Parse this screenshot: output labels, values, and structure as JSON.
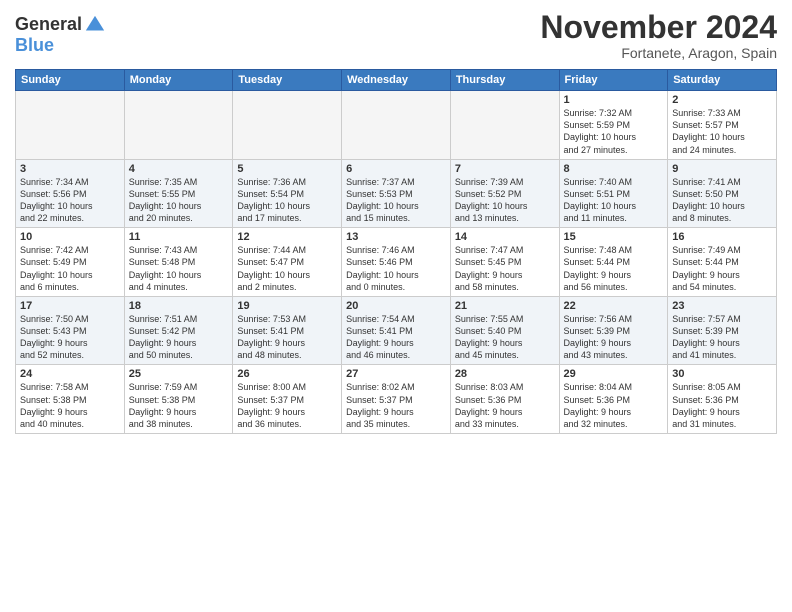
{
  "logo": {
    "line1": "General",
    "line2": "Blue"
  },
  "title": "November 2024",
  "subtitle": "Fortanete, Aragon, Spain",
  "weekdays": [
    "Sunday",
    "Monday",
    "Tuesday",
    "Wednesday",
    "Thursday",
    "Friday",
    "Saturday"
  ],
  "rows": [
    [
      {
        "day": "",
        "info": ""
      },
      {
        "day": "",
        "info": ""
      },
      {
        "day": "",
        "info": ""
      },
      {
        "day": "",
        "info": ""
      },
      {
        "day": "",
        "info": ""
      },
      {
        "day": "1",
        "info": "Sunrise: 7:32 AM\nSunset: 5:59 PM\nDaylight: 10 hours\nand 27 minutes."
      },
      {
        "day": "2",
        "info": "Sunrise: 7:33 AM\nSunset: 5:57 PM\nDaylight: 10 hours\nand 24 minutes."
      }
    ],
    [
      {
        "day": "3",
        "info": "Sunrise: 7:34 AM\nSunset: 5:56 PM\nDaylight: 10 hours\nand 22 minutes."
      },
      {
        "day": "4",
        "info": "Sunrise: 7:35 AM\nSunset: 5:55 PM\nDaylight: 10 hours\nand 20 minutes."
      },
      {
        "day": "5",
        "info": "Sunrise: 7:36 AM\nSunset: 5:54 PM\nDaylight: 10 hours\nand 17 minutes."
      },
      {
        "day": "6",
        "info": "Sunrise: 7:37 AM\nSunset: 5:53 PM\nDaylight: 10 hours\nand 15 minutes."
      },
      {
        "day": "7",
        "info": "Sunrise: 7:39 AM\nSunset: 5:52 PM\nDaylight: 10 hours\nand 13 minutes."
      },
      {
        "day": "8",
        "info": "Sunrise: 7:40 AM\nSunset: 5:51 PM\nDaylight: 10 hours\nand 11 minutes."
      },
      {
        "day": "9",
        "info": "Sunrise: 7:41 AM\nSunset: 5:50 PM\nDaylight: 10 hours\nand 8 minutes."
      }
    ],
    [
      {
        "day": "10",
        "info": "Sunrise: 7:42 AM\nSunset: 5:49 PM\nDaylight: 10 hours\nand 6 minutes."
      },
      {
        "day": "11",
        "info": "Sunrise: 7:43 AM\nSunset: 5:48 PM\nDaylight: 10 hours\nand 4 minutes."
      },
      {
        "day": "12",
        "info": "Sunrise: 7:44 AM\nSunset: 5:47 PM\nDaylight: 10 hours\nand 2 minutes."
      },
      {
        "day": "13",
        "info": "Sunrise: 7:46 AM\nSunset: 5:46 PM\nDaylight: 10 hours\nand 0 minutes."
      },
      {
        "day": "14",
        "info": "Sunrise: 7:47 AM\nSunset: 5:45 PM\nDaylight: 9 hours\nand 58 minutes."
      },
      {
        "day": "15",
        "info": "Sunrise: 7:48 AM\nSunset: 5:44 PM\nDaylight: 9 hours\nand 56 minutes."
      },
      {
        "day": "16",
        "info": "Sunrise: 7:49 AM\nSunset: 5:44 PM\nDaylight: 9 hours\nand 54 minutes."
      }
    ],
    [
      {
        "day": "17",
        "info": "Sunrise: 7:50 AM\nSunset: 5:43 PM\nDaylight: 9 hours\nand 52 minutes."
      },
      {
        "day": "18",
        "info": "Sunrise: 7:51 AM\nSunset: 5:42 PM\nDaylight: 9 hours\nand 50 minutes."
      },
      {
        "day": "19",
        "info": "Sunrise: 7:53 AM\nSunset: 5:41 PM\nDaylight: 9 hours\nand 48 minutes."
      },
      {
        "day": "20",
        "info": "Sunrise: 7:54 AM\nSunset: 5:41 PM\nDaylight: 9 hours\nand 46 minutes."
      },
      {
        "day": "21",
        "info": "Sunrise: 7:55 AM\nSunset: 5:40 PM\nDaylight: 9 hours\nand 45 minutes."
      },
      {
        "day": "22",
        "info": "Sunrise: 7:56 AM\nSunset: 5:39 PM\nDaylight: 9 hours\nand 43 minutes."
      },
      {
        "day": "23",
        "info": "Sunrise: 7:57 AM\nSunset: 5:39 PM\nDaylight: 9 hours\nand 41 minutes."
      }
    ],
    [
      {
        "day": "24",
        "info": "Sunrise: 7:58 AM\nSunset: 5:38 PM\nDaylight: 9 hours\nand 40 minutes."
      },
      {
        "day": "25",
        "info": "Sunrise: 7:59 AM\nSunset: 5:38 PM\nDaylight: 9 hours\nand 38 minutes."
      },
      {
        "day": "26",
        "info": "Sunrise: 8:00 AM\nSunset: 5:37 PM\nDaylight: 9 hours\nand 36 minutes."
      },
      {
        "day": "27",
        "info": "Sunrise: 8:02 AM\nSunset: 5:37 PM\nDaylight: 9 hours\nand 35 minutes."
      },
      {
        "day": "28",
        "info": "Sunrise: 8:03 AM\nSunset: 5:36 PM\nDaylight: 9 hours\nand 33 minutes."
      },
      {
        "day": "29",
        "info": "Sunrise: 8:04 AM\nSunset: 5:36 PM\nDaylight: 9 hours\nand 32 minutes."
      },
      {
        "day": "30",
        "info": "Sunrise: 8:05 AM\nSunset: 5:36 PM\nDaylight: 9 hours\nand 31 minutes."
      }
    ]
  ]
}
